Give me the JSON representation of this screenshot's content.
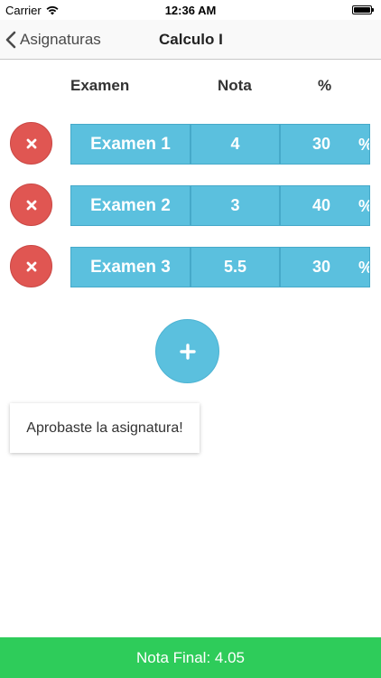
{
  "status_bar": {
    "carrier": "Carrier",
    "time": "12:36 AM"
  },
  "navbar": {
    "back_label": "Asignaturas",
    "title": "Calculo I"
  },
  "columns": {
    "examen": "Examen",
    "nota": "Nota",
    "percent": "%"
  },
  "exams": [
    {
      "name": "Examen 1",
      "nota": "4",
      "percent": "30",
      "percent_sign": "%"
    },
    {
      "name": "Examen 2",
      "nota": "3",
      "percent": "40",
      "percent_sign": "%"
    },
    {
      "name": "Examen 3",
      "nota": "5.5",
      "percent": "30",
      "percent_sign": "%"
    }
  ],
  "result": {
    "message": "Aprobaste la asignatura!"
  },
  "footer": {
    "final_grade_label": "Nota Final: 4.05"
  },
  "colors": {
    "cell": "#5bc0de",
    "delete": "#e05652",
    "footer": "#2ecc5a"
  }
}
